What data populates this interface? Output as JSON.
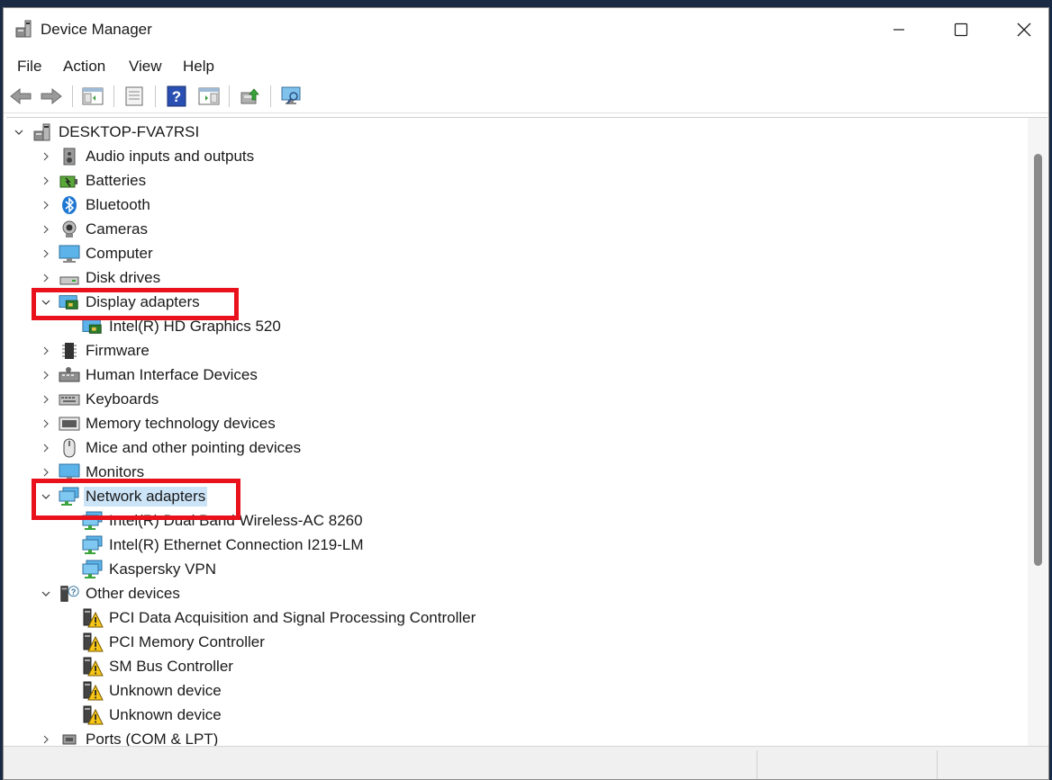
{
  "window": {
    "title": "Device Manager",
    "controls": {
      "minimize": "minimize-icon",
      "maximize": "maximize-icon",
      "close": "close-icon"
    }
  },
  "menu": [
    "File",
    "Action",
    "View",
    "Help"
  ],
  "toolbar": {
    "buttons": [
      "back-icon",
      "forward-icon",
      "show-hide-console-tree-icon",
      "properties-icon",
      "help-icon",
      "action-pane-icon",
      "update-driver-icon",
      "scan-hardware-icon"
    ]
  },
  "tree": {
    "root": {
      "label": "DESKTOP-FVA7RSI",
      "expanded": true,
      "icon": "computer-tower-icon"
    },
    "items": [
      {
        "label": "Audio inputs and outputs",
        "icon": "speaker-icon",
        "expanded": false,
        "level": 1
      },
      {
        "label": "Batteries",
        "icon": "battery-icon",
        "expanded": false,
        "level": 1
      },
      {
        "label": "Bluetooth",
        "icon": "bluetooth-icon",
        "expanded": false,
        "level": 1
      },
      {
        "label": "Cameras",
        "icon": "camera-icon",
        "expanded": false,
        "level": 1
      },
      {
        "label": "Computer",
        "icon": "monitor-icon",
        "expanded": false,
        "level": 1
      },
      {
        "label": "Disk drives",
        "icon": "disk-drive-icon",
        "expanded": false,
        "level": 1
      },
      {
        "label": "Display adapters",
        "icon": "display-adapter-icon",
        "expanded": true,
        "level": 1
      },
      {
        "label": "Intel(R) HD Graphics 520",
        "icon": "display-adapter-icon",
        "level": 2
      },
      {
        "label": "Firmware",
        "icon": "chip-icon",
        "expanded": false,
        "level": 1
      },
      {
        "label": "Human Interface Devices",
        "icon": "hid-icon",
        "expanded": false,
        "level": 1
      },
      {
        "label": "Keyboards",
        "icon": "keyboard-icon",
        "expanded": false,
        "level": 1
      },
      {
        "label": "Memory technology devices",
        "icon": "memory-icon",
        "expanded": false,
        "level": 1
      },
      {
        "label": "Mice and other pointing devices",
        "icon": "mouse-icon",
        "expanded": false,
        "level": 1
      },
      {
        "label": "Monitors",
        "icon": "monitor-icon",
        "expanded": false,
        "level": 1
      },
      {
        "label": "Network adapters",
        "icon": "network-adapter-icon",
        "expanded": true,
        "selected": true,
        "level": 1
      },
      {
        "label": "Intel(R) Dual Band Wireless-AC 8260",
        "icon": "network-adapter-icon",
        "level": 2
      },
      {
        "label": "Intel(R) Ethernet Connection I219-LM",
        "icon": "network-adapter-icon",
        "level": 2
      },
      {
        "label": "Kaspersky VPN",
        "icon": "network-adapter-icon",
        "level": 2
      },
      {
        "label": "Other devices",
        "icon": "unknown-device-icon",
        "expanded": true,
        "level": 1
      },
      {
        "label": "PCI Data Acquisition and Signal Processing Controller",
        "icon": "warning-device-icon",
        "level": 2
      },
      {
        "label": "PCI Memory Controller",
        "icon": "warning-device-icon",
        "level": 2
      },
      {
        "label": "SM Bus Controller",
        "icon": "warning-device-icon",
        "level": 2
      },
      {
        "label": "Unknown device",
        "icon": "warning-device-icon",
        "level": 2
      },
      {
        "label": "Unknown device",
        "icon": "warning-device-icon",
        "level": 2
      },
      {
        "label": "Ports (COM & LPT)",
        "icon": "port-icon",
        "expanded": false,
        "level": 1
      }
    ]
  },
  "annotations": {
    "highlight_color": "#e8111c",
    "highlighted_items": [
      "Display adapters",
      "Network adapters"
    ]
  },
  "colors": {
    "selection": "#cce4f7",
    "accent_blue": "#1e78d2"
  }
}
